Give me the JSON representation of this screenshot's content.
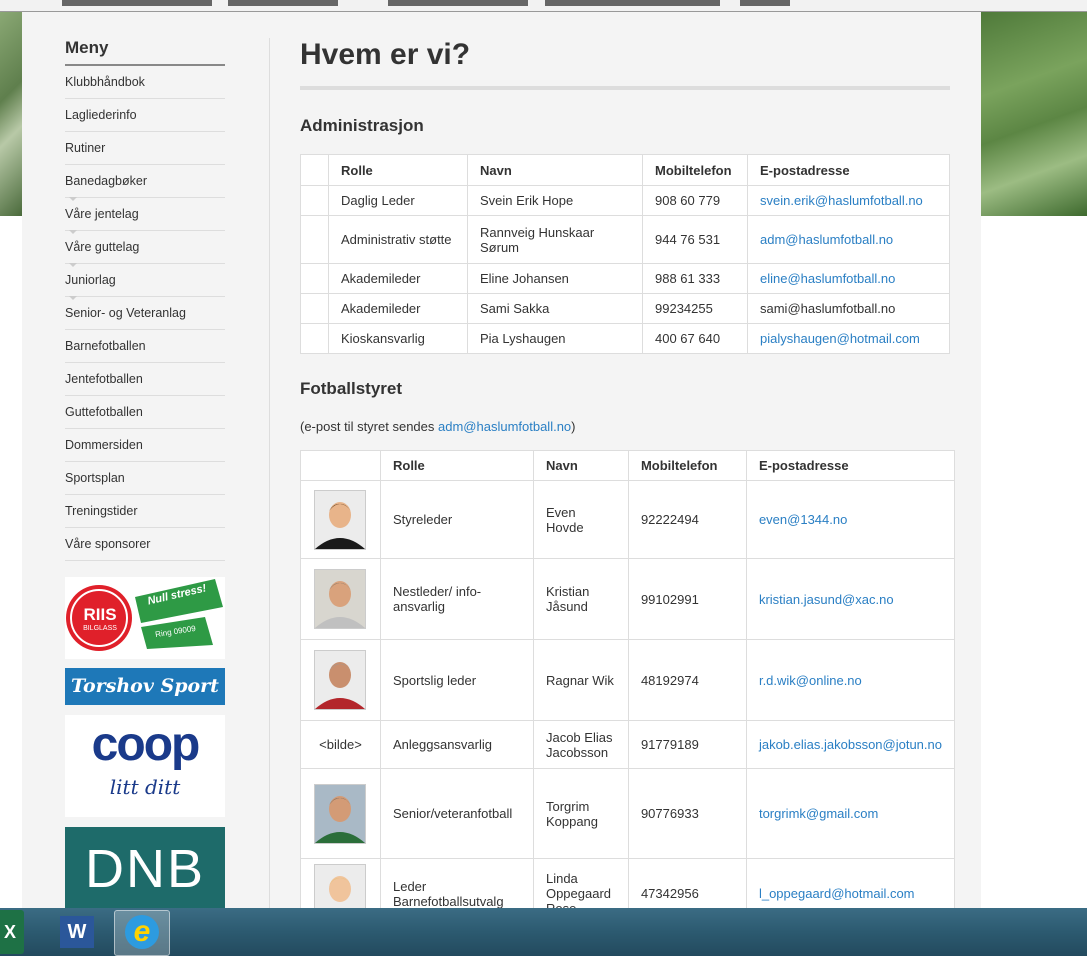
{
  "menu": {
    "title": "Meny",
    "items": [
      {
        "label": "Klubbhåndbok",
        "sub": false
      },
      {
        "label": "Lagliederinfo",
        "sub": false
      },
      {
        "label": "Rutiner",
        "sub": false
      },
      {
        "label": "Banedagbøker",
        "sub": false
      },
      {
        "label": "Våre jentelag",
        "sub": true
      },
      {
        "label": "Våre guttelag",
        "sub": true
      },
      {
        "label": "Juniorlag",
        "sub": true
      },
      {
        "label": "Senior- og Veteranlag",
        "sub": true
      },
      {
        "label": "Barnefotballen",
        "sub": false
      },
      {
        "label": "Jentefotballen",
        "sub": false
      },
      {
        "label": "Guttefotballen",
        "sub": false
      },
      {
        "label": "Dommersiden",
        "sub": false
      },
      {
        "label": "Sportsplan",
        "sub": false
      },
      {
        "label": "Treningstider",
        "sub": false
      },
      {
        "label": "Våre sponsorer",
        "sub": false
      }
    ]
  },
  "sponsors": {
    "riis": {
      "name": "RIIS",
      "sub": "BILGLASS",
      "slogan": "Null stress!",
      "phone": "Ring 09009"
    },
    "torshov": "Torshov Sport",
    "coop": {
      "name": "coop",
      "slogan": "litt ditt"
    },
    "dnb": "DNB"
  },
  "page": {
    "title": "Hvem er vi?",
    "admin_heading": "Administrasjon",
    "board_heading": "Fotballstyret",
    "board_note_prefix": "(e-post til styret sendes ",
    "board_note_email": "adm@haslumfotball.no",
    "board_note_suffix": ")"
  },
  "columns": {
    "role": "Rolle",
    "name": "Navn",
    "phone": "Mobiltelefon",
    "email": "E-postadresse"
  },
  "admin_rows": [
    {
      "role": "Daglig Leder",
      "name": "Svein Erik Hope",
      "phone": "908 60 779",
      "email": " svein.erik@haslumfotball.no",
      "link": true
    },
    {
      "role": "Administrativ støtte",
      "name": "Rannveig Hunskaar Sørum",
      "phone": "944 76 531",
      "email": "adm@haslumfotball.no",
      "link": true
    },
    {
      "role": "Akademileder",
      "name": "Eline Johansen",
      "phone": "988 61 333",
      "email": "eline@haslumfotball.no",
      "link": true
    },
    {
      "role": "Akademileder",
      "name": "Sami Sakka",
      "phone": "99234255",
      "email": "sami@haslumfotball.no",
      "link": false
    },
    {
      "role": "Kioskansvarlig",
      "name": "Pia Lyshaugen",
      "phone": "400 67 640",
      "email": "pialyshaugen@hotmail.com",
      "link": true
    }
  ],
  "board_rows": [
    {
      "photo": "photo",
      "role": "Styreleder",
      "name": "Even Hovde",
      "phone": " 92222494",
      "email": "even@1344.no"
    },
    {
      "photo": "photo",
      "role": " Nestleder/ info-ansvarlig",
      "name": "Kristian Jåsund",
      "phone": " 99102991",
      "email": "kristian.jasund@xac.no"
    },
    {
      "photo": "photo",
      "role": " Sportslig leder",
      "name": "Ragnar Wik",
      "phone": "48192974",
      "email": "r.d.wik@online.no"
    },
    {
      "photo": "text",
      "photo_text": "<bilde>",
      "role": "Anleggsansvarlig",
      "name": "Jacob Elias Jacobsson",
      "phone": "91779189",
      "email": "jakob.elias.jakobsson@jotun.no"
    },
    {
      "photo": "photo",
      "role": "Senior/veteranfotball",
      "name": "Torgrim Koppang",
      "phone": "90776933",
      "email": "torgrimk@gmail.com"
    },
    {
      "photo": "photo",
      "role": "Leder Barnefotballsutvalg",
      "name": "Linda Oppegaard Rose",
      "phone": "47342956",
      "email": "l_oppegaard@hotmail.com"
    }
  ]
}
